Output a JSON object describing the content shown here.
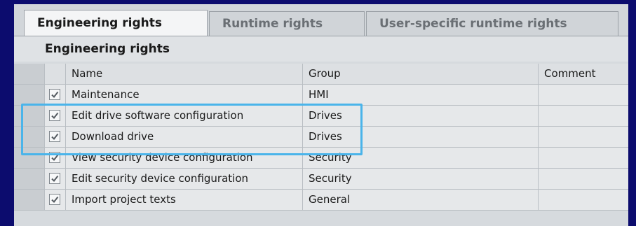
{
  "tabs": [
    {
      "label": "Engineering rights",
      "active": true
    },
    {
      "label": "Runtime rights",
      "active": false
    },
    {
      "label": "User-specific runtime rights",
      "active": false
    }
  ],
  "section_title": "Engineering rights",
  "columns": {
    "name": "Name",
    "group": "Group",
    "comment": "Comment"
  },
  "rows": [
    {
      "checked": true,
      "name": "Maintenance",
      "group": "HMI",
      "comment": ""
    },
    {
      "checked": true,
      "name": "Edit drive software configuration",
      "group": "Drives",
      "comment": ""
    },
    {
      "checked": true,
      "name": "Download drive",
      "group": "Drives",
      "comment": ""
    },
    {
      "checked": true,
      "name": "View security device configuration",
      "group": "Security",
      "comment": ""
    },
    {
      "checked": true,
      "name": "Edit security device configuration",
      "group": "Security",
      "comment": ""
    },
    {
      "checked": true,
      "name": "Import project texts",
      "group": "General",
      "comment": ""
    }
  ],
  "colors": {
    "highlight": "#4ab4ea",
    "background": "#0c0c6e"
  }
}
